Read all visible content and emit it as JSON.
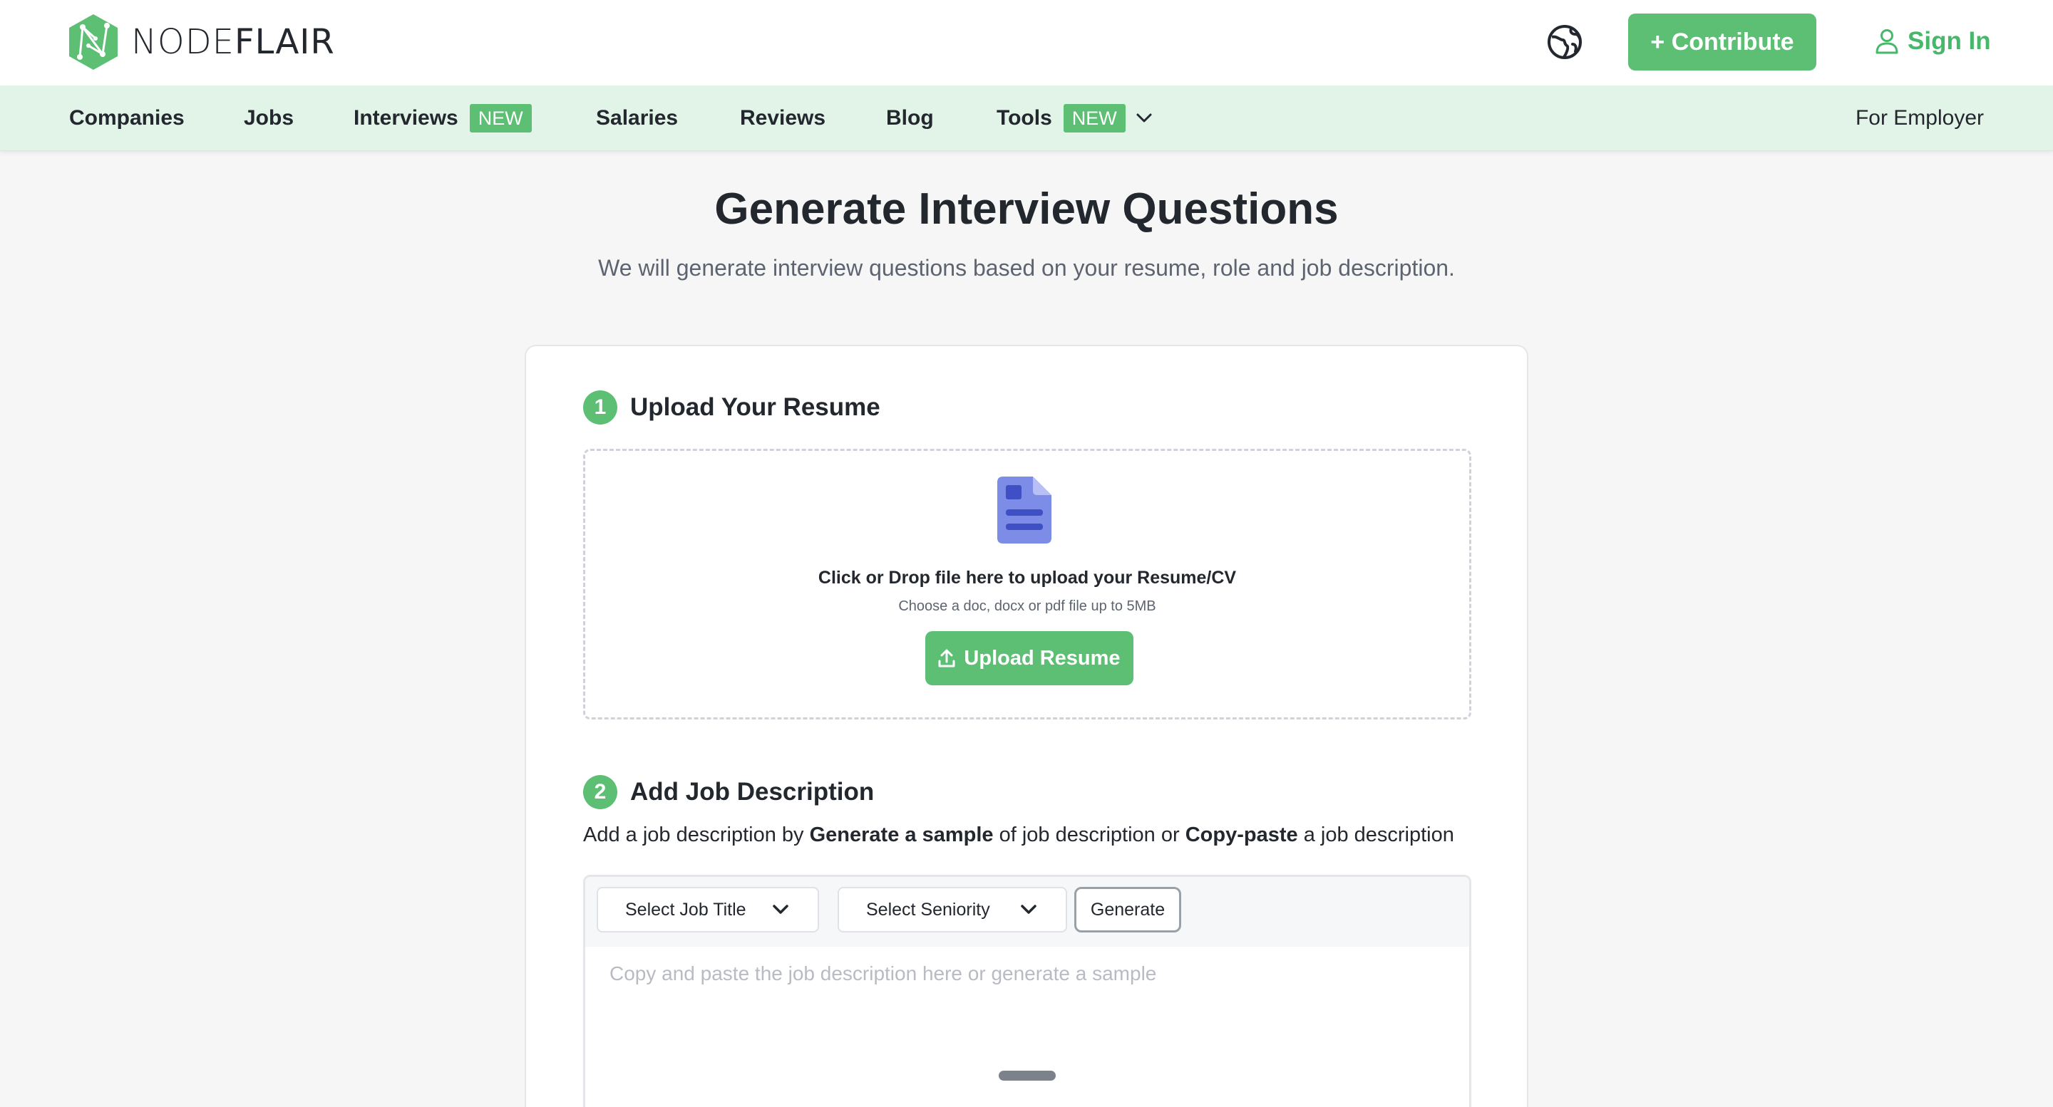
{
  "brand": {
    "name_light": "NODE",
    "name_bold": "FLAIR",
    "accent": "#5cbf74",
    "nav_bg": "#e2f4e8"
  },
  "header": {
    "language_icon": "globe-icon",
    "contribute_label": "+ Contribute",
    "signin_label": "Sign In"
  },
  "nav": {
    "companies": "Companies",
    "jobs": "Jobs",
    "interviews": "Interviews",
    "interviews_badge": "NEW",
    "salaries": "Salaries",
    "reviews": "Reviews",
    "blog": "Blog",
    "tools": "Tools",
    "tools_badge": "NEW",
    "for_employer": "For Employer"
  },
  "page": {
    "title": "Generate Interview Questions",
    "subtitle": "We will generate interview questions based on your resume, role and job description."
  },
  "step1": {
    "number": "1",
    "title": "Upload Your Resume",
    "drop_title": "Click or Drop file here to upload your Resume/CV",
    "drop_hint": "Choose a doc, docx or pdf file up to 5MB",
    "upload_label": "Upload Resume"
  },
  "step2": {
    "number": "2",
    "title": "Add Job Description",
    "desc_prefix": "Add a job description by ",
    "desc_bold1": "Generate a sample",
    "desc_middle": " of job description or ",
    "desc_bold2": "Copy-paste",
    "desc_suffix": " a job description",
    "job_title_select": "Select Job Title",
    "seniority_select": "Select Seniority",
    "generate_label": "Generate",
    "textarea_placeholder": "Copy and paste the job description here or generate a sample",
    "textarea_value": ""
  }
}
